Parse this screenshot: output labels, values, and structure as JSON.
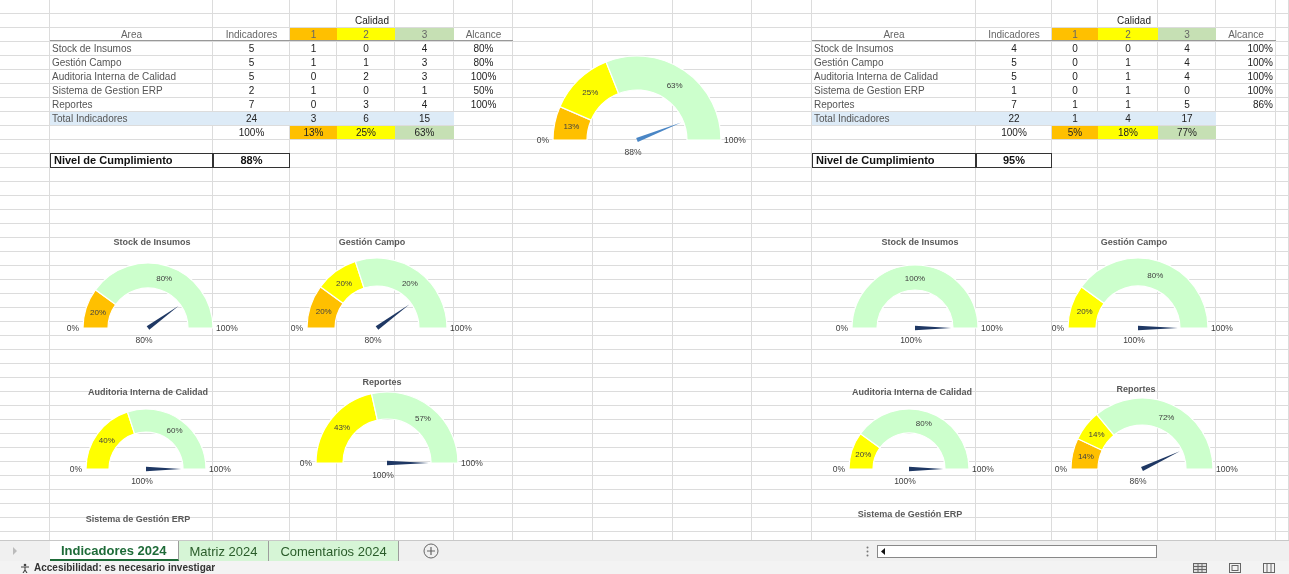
{
  "tables": [
    {
      "group_header": "Calidad",
      "columns": [
        {
          "label": "Area"
        },
        {
          "label": "Indicadores"
        },
        {
          "label": "1",
          "color": "#ffc000"
        },
        {
          "label": "2",
          "color": "#ffff00"
        },
        {
          "label": "3",
          "color": "#c6e0b4"
        },
        {
          "label": "Alcance"
        }
      ],
      "rows": [
        [
          "Stock de Insumos",
          "5",
          "1",
          "0",
          "4",
          "80%"
        ],
        [
          "Gestión Campo",
          "5",
          "1",
          "1",
          "3",
          "80%"
        ],
        [
          "Auditoria Interna de Calidad",
          "5",
          "0",
          "2",
          "3",
          "100%"
        ],
        [
          "Sistema de Gestion ERP",
          "2",
          "1",
          "0",
          "1",
          "50%"
        ],
        [
          "Reportes",
          "7",
          "0",
          "3",
          "4",
          "100%"
        ]
      ],
      "total": {
        "label": "Total Indicadores",
        "cells": [
          "24",
          "3",
          "6",
          "15"
        ]
      },
      "shares": [
        "100%",
        "13%",
        "25%",
        "63%"
      ],
      "compliance": {
        "label": "Nivel de Cumplimiento",
        "value": "88%"
      }
    },
    {
      "group_header": "Calidad",
      "columns": [
        {
          "label": "Area"
        },
        {
          "label": "Indicadores"
        },
        {
          "label": "1",
          "color": "#ffc000"
        },
        {
          "label": "2",
          "color": "#ffff00"
        },
        {
          "label": "3",
          "color": "#c6e0b4"
        },
        {
          "label": "Alcance"
        }
      ],
      "rows": [
        [
          "Stock de Insumos",
          "4",
          "0",
          "0",
          "4",
          "100%"
        ],
        [
          "Gestión Campo",
          "5",
          "0",
          "1",
          "4",
          "100%"
        ],
        [
          "Auditoria Interna de Calidad",
          "5",
          "0",
          "1",
          "4",
          "100%"
        ],
        [
          "Sistema de Gestion ERP",
          "1",
          "0",
          "1",
          "0",
          "100%"
        ],
        [
          "Reportes",
          "7",
          "1",
          "1",
          "5",
          "86%"
        ]
      ],
      "total": {
        "label": "Total Indicadores",
        "cells": [
          "22",
          "1",
          "4",
          "17"
        ]
      },
      "shares": [
        "100%",
        "5%",
        "18%",
        "77%"
      ],
      "compliance": {
        "label": "Nivel de Cumplimiento",
        "value": "95%"
      }
    }
  ],
  "gauges": [
    {
      "min_label": "0%",
      "max_label": "100%",
      "segments": [
        {
          "label": "13%",
          "color": "#ffc000"
        },
        {
          "label": "25%",
          "color": "#ffff00"
        },
        {
          "label": "63%",
          "color": "#ccffcc"
        }
      ],
      "needle": {
        "reading": "88%"
      }
    },
    {
      "title": "Stock de Insumos",
      "min_label": "0%",
      "max_label": "100%",
      "segments": [
        {
          "label": "20%",
          "color": "#ffc000"
        },
        {
          "label": "80%",
          "color": "#ccffcc"
        }
      ],
      "needle": {
        "reading": "80%"
      }
    },
    {
      "title": "Gestión Campo",
      "min_label": "0%",
      "max_label": "100%",
      "segments": [
        {
          "label": "20%",
          "color": "#ffc000"
        },
        {
          "label": "20%",
          "color": "#ffff00"
        },
        {
          "label": "20%",
          "color": "#ccffcc"
        }
      ],
      "needle": {
        "reading": "80%"
      }
    },
    {
      "title": "Stock de Insumos",
      "min_label": "0%",
      "max_label": "100%",
      "segments": [
        {
          "label": "100%",
          "color": "#ccffcc"
        }
      ],
      "needle": {
        "reading": "100%"
      }
    },
    {
      "title": "Gestión Campo",
      "min_label": "0%",
      "max_label": "100%",
      "segments": [
        {
          "label": "20%",
          "color": "#ffff00"
        },
        {
          "label": "80%",
          "color": "#ccffcc"
        }
      ],
      "needle": {
        "reading": "100%"
      }
    },
    {
      "title": "Auditoria Interna de Calidad",
      "min_label": "0%",
      "max_label": "100%",
      "segments": [
        {
          "label": "40%",
          "color": "#ffff00"
        },
        {
          "label": "60%",
          "color": "#ccffcc"
        }
      ],
      "needle": {
        "reading": "100%"
      }
    },
    {
      "title": "Reportes",
      "min_label": "0%",
      "max_label": "100%",
      "segments": [
        {
          "label": "43%",
          "color": "#ffff00"
        },
        {
          "label": "57%",
          "color": "#ccffcc"
        }
      ],
      "needle": {
        "reading": "100%"
      }
    },
    {
      "title": "Auditoria Interna de Calidad",
      "min_label": "0%",
      "max_label": "100%",
      "segments": [
        {
          "label": "20%",
          "color": "#ffff00"
        },
        {
          "label": "80%",
          "color": "#ccffcc"
        }
      ],
      "needle": {
        "reading": "100%"
      }
    },
    {
      "title": "Reportes",
      "min_label": "0%",
      "max_label": "100%",
      "segments": [
        {
          "label": "14%",
          "color": "#ffc000"
        },
        {
          "label": "14%",
          "color": "#ffff00"
        },
        {
          "label": "72%",
          "color": "#ccffcc"
        }
      ],
      "needle": {
        "reading": "86%"
      }
    },
    {
      "title": "Sistema de Gestión ERP"
    },
    {
      "title": "Sistema de Gestión ERP"
    }
  ],
  "sheet_tabs": [
    {
      "label": "Indicadores 2024",
      "selected": true
    },
    {
      "label": "Matriz 2024",
      "selected": false
    },
    {
      "label": "Comentarios 2024",
      "selected": false
    }
  ],
  "status_bar": {
    "text": "Accesibilidad: es necesario investigar"
  }
}
